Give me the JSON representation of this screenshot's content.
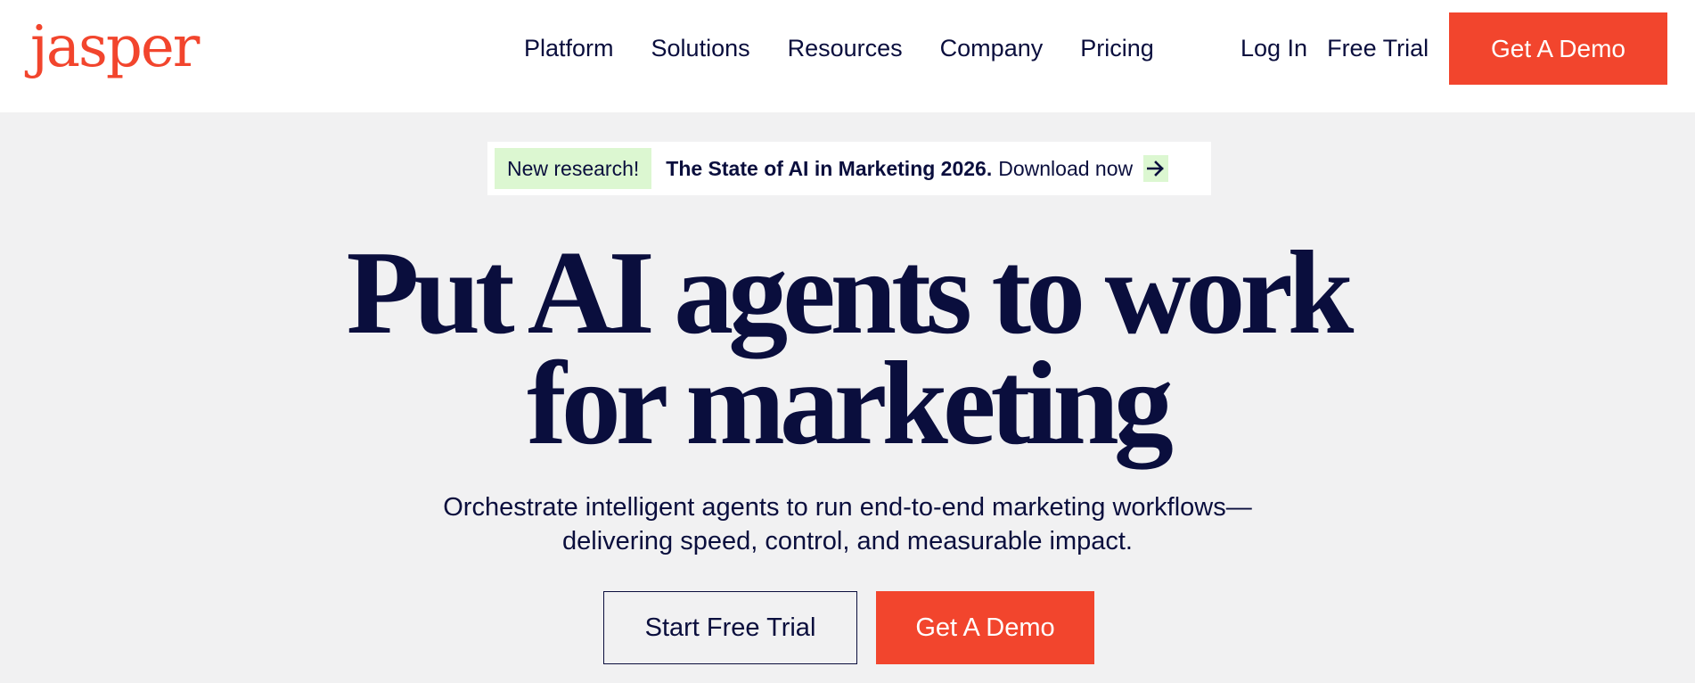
{
  "brand": {
    "logo_text": "jasper",
    "accent_color": "#f2452d",
    "ink_color": "#0a0e3d"
  },
  "nav": {
    "items": [
      {
        "label": "Platform"
      },
      {
        "label": "Solutions"
      },
      {
        "label": "Resources"
      },
      {
        "label": "Company"
      },
      {
        "label": "Pricing"
      }
    ],
    "login_label": "Log In",
    "free_trial_label": "Free Trial",
    "demo_label": "Get A Demo"
  },
  "banner": {
    "tag": "New research!",
    "title": "The State of AI in Marketing 2026.",
    "link_label": "Download now",
    "tag_color": "#dcf7d1",
    "arrow_icon": "arrow-right-icon"
  },
  "hero": {
    "headline_line1": "Put AI agents to work",
    "headline_line2": "for marketing",
    "subhead_line1": "Orchestrate intelligent agents to run end-to-end marketing workflows—",
    "subhead_line2": "delivering speed, control, and measurable impact.",
    "primary_cta": "Start Free Trial",
    "secondary_cta": "Get A Demo"
  }
}
